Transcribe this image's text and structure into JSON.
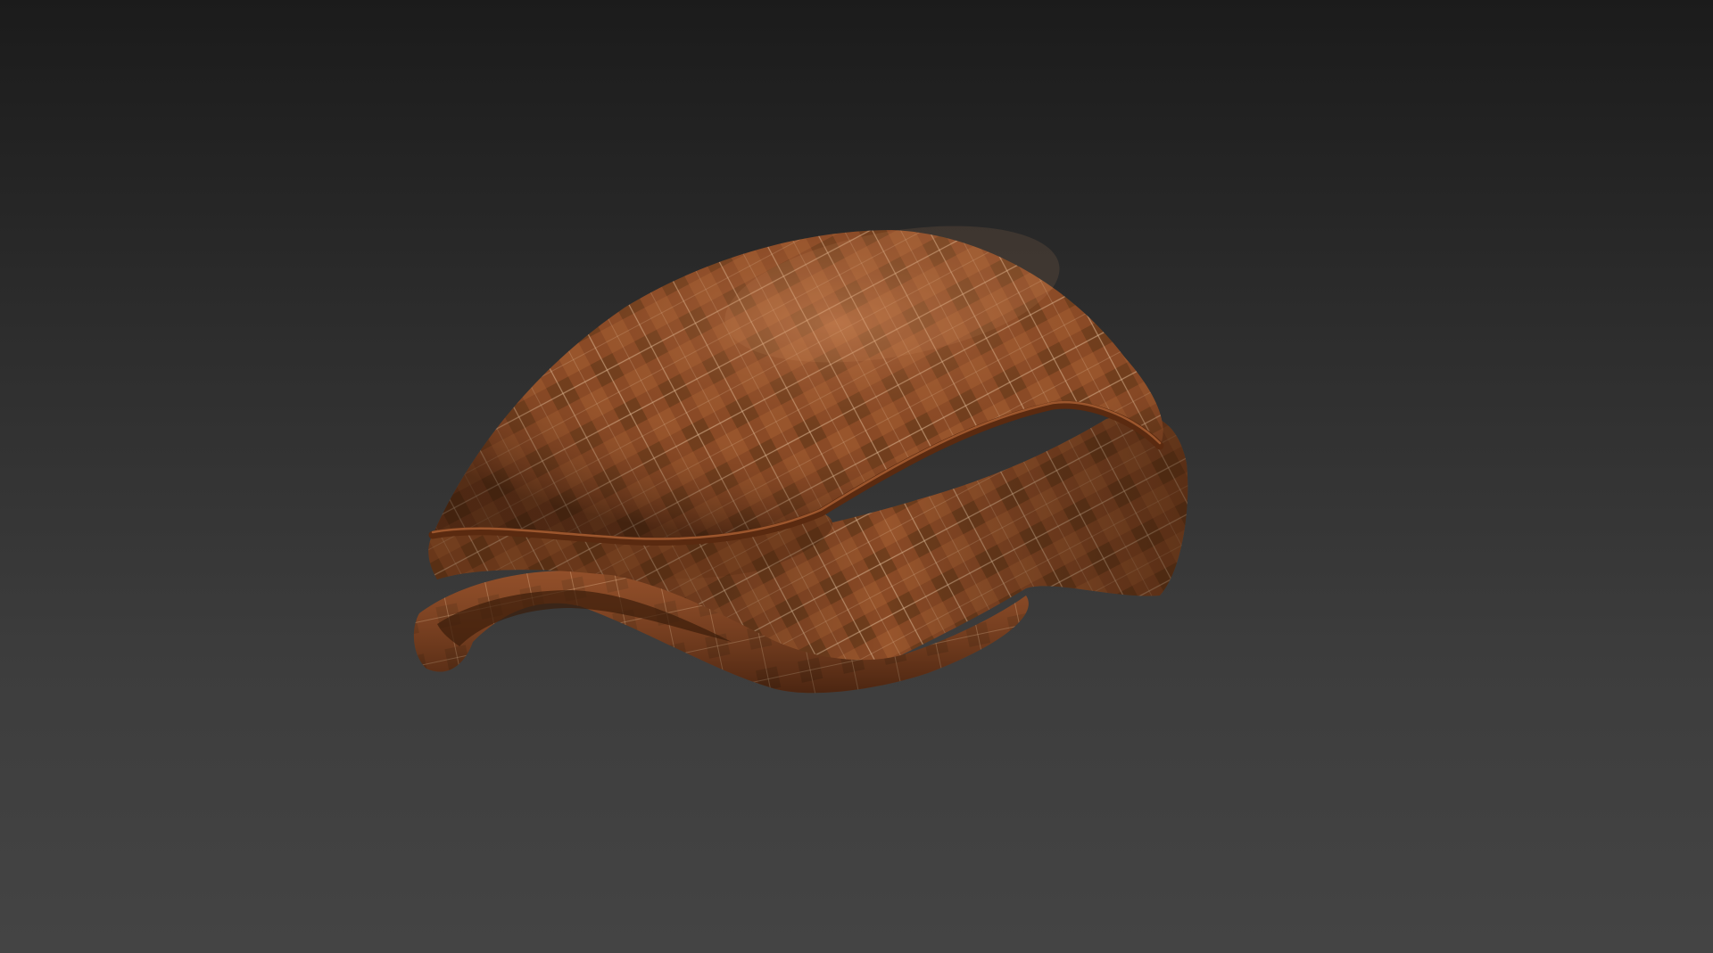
{
  "scene": {
    "subject": "flat-cap",
    "material": "brown-plaid-wool"
  },
  "colors": {
    "background_top": "#1b1b1b",
    "background_bottom": "#444444",
    "fabric_base": "#8a4a26",
    "fabric_light": "#b56b3a",
    "fabric_dark": "#4a2612",
    "plaid_line": "#e8c4a0",
    "plaid_block": "#5a3416"
  }
}
